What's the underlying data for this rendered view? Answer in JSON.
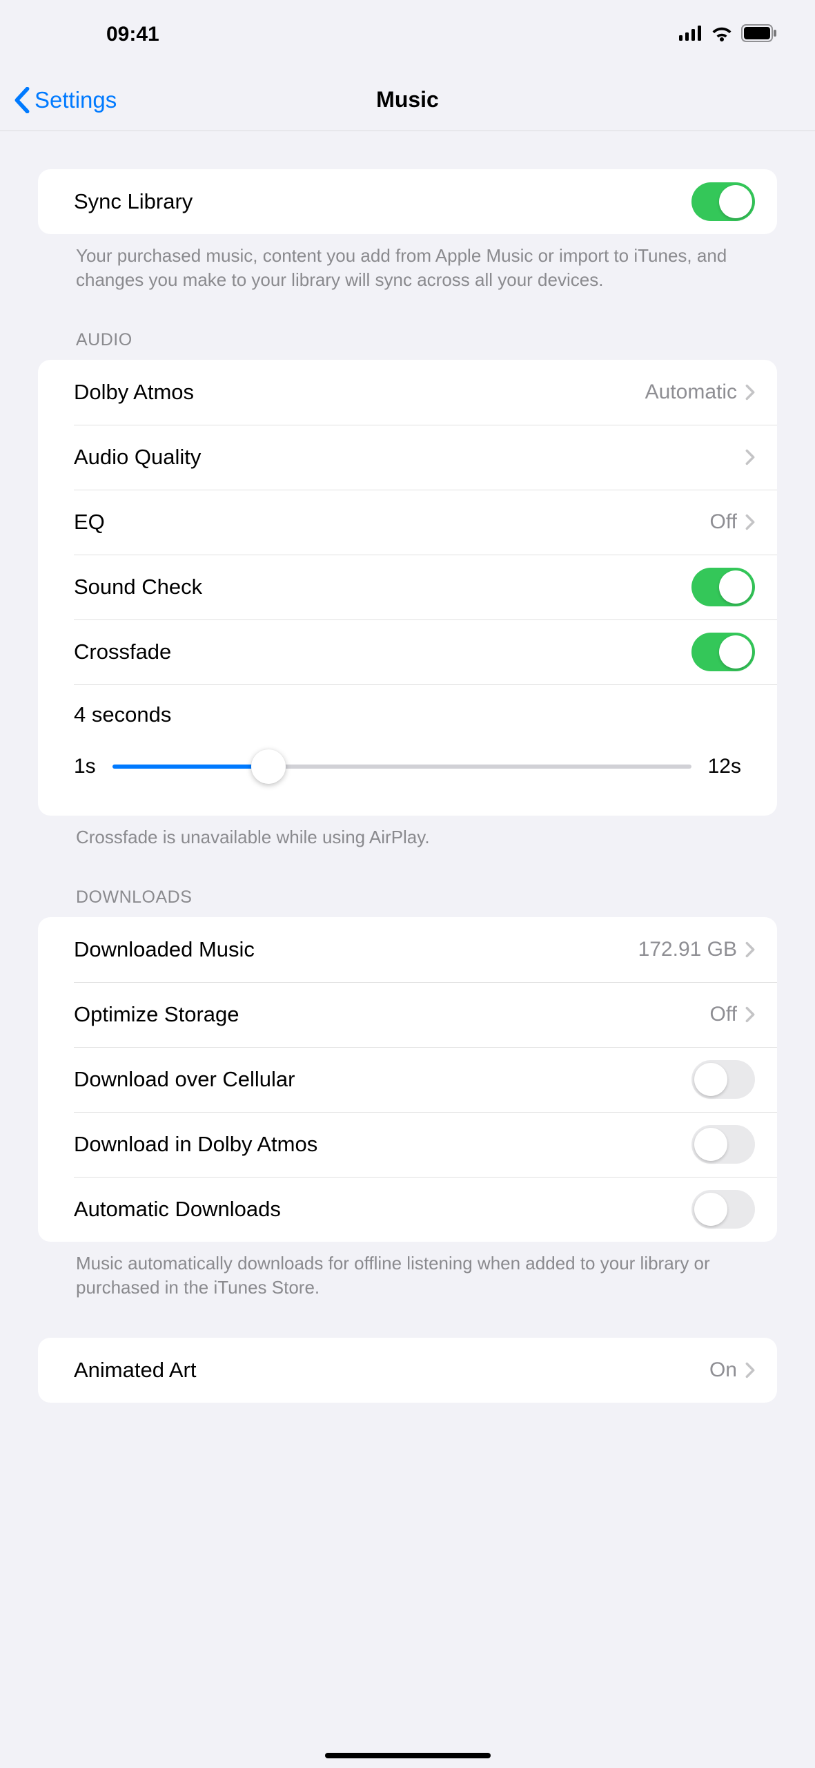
{
  "status": {
    "time": "09:41"
  },
  "nav": {
    "back_label": "Settings",
    "title": "Music"
  },
  "groups": {
    "library": {
      "sync_library": {
        "label": "Sync Library",
        "on": true
      },
      "footer": "Your purchased music, content you add from Apple Music or import to iTunes, and changes you make to your library will sync across all your devices."
    },
    "audio": {
      "header": "AUDIO",
      "dolby_atmos": {
        "label": "Dolby Atmos",
        "detail": "Automatic"
      },
      "audio_quality": {
        "label": "Audio Quality"
      },
      "eq": {
        "label": "EQ",
        "detail": "Off"
      },
      "sound_check": {
        "label": "Sound Check",
        "on": true
      },
      "crossfade": {
        "label": "Crossfade",
        "on": true
      },
      "crossfade_slider": {
        "value_label": "4 seconds",
        "min_label": "1s",
        "max_label": "12s",
        "percent": 27
      },
      "footer": "Crossfade is unavailable while using AirPlay."
    },
    "downloads": {
      "header": "DOWNLOADS",
      "downloaded_music": {
        "label": "Downloaded Music",
        "detail": "172.91 GB"
      },
      "optimize_storage": {
        "label": "Optimize Storage",
        "detail": "Off"
      },
      "download_cellular": {
        "label": "Download over Cellular",
        "on": false
      },
      "download_dolby": {
        "label": "Download in Dolby Atmos",
        "on": false
      },
      "automatic_downloads": {
        "label": "Automatic Downloads",
        "on": false
      },
      "footer": "Music automatically downloads for offline listening when added to your library or purchased in the iTunes Store."
    },
    "art": {
      "animated_art": {
        "label": "Animated Art",
        "detail": "On"
      }
    }
  }
}
